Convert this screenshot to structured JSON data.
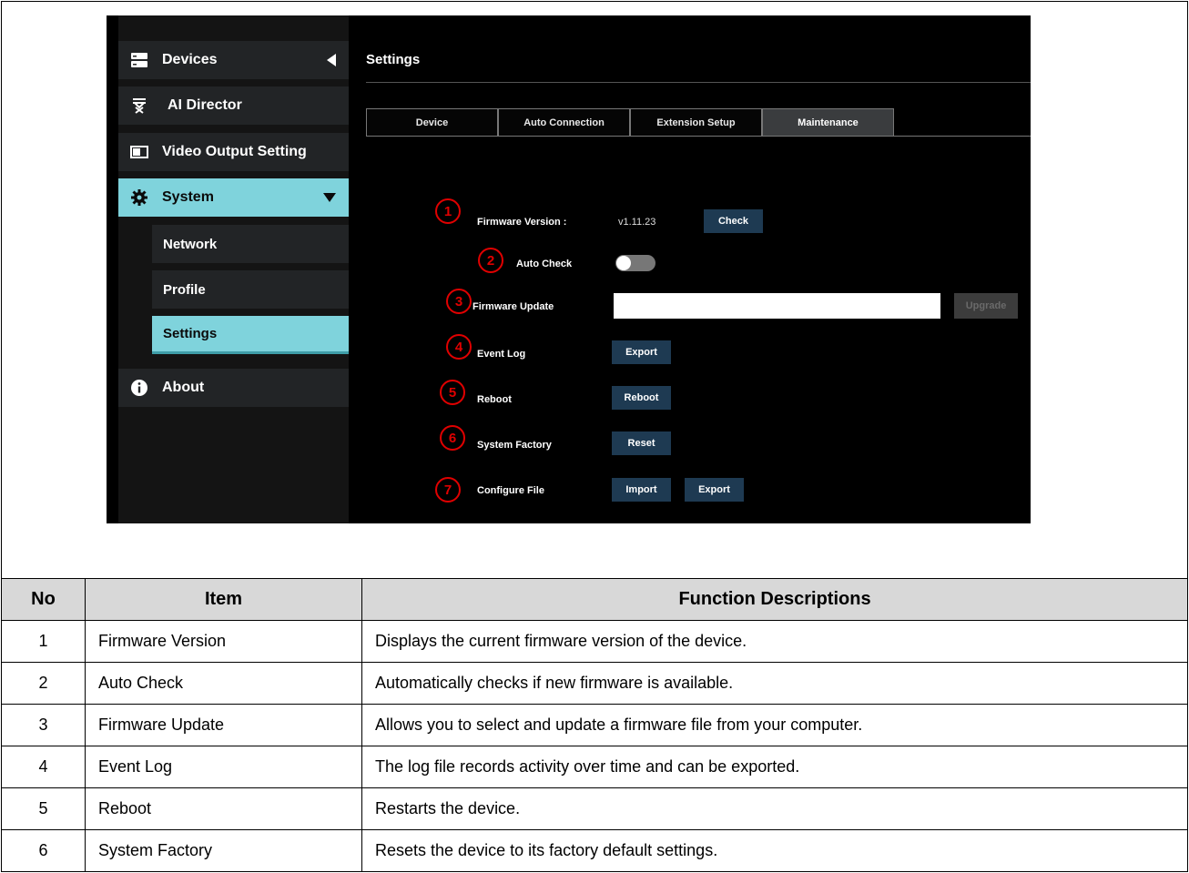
{
  "sidebar": {
    "items": [
      {
        "label": "Devices",
        "icon": "server-icon"
      },
      {
        "label": "AI Director",
        "icon": "director-chair-icon"
      },
      {
        "label": "Video Output Setting",
        "icon": "display-icon"
      },
      {
        "label": "System",
        "icon": "gear-icon"
      },
      {
        "label": "About",
        "icon": "info-icon"
      }
    ],
    "sub_items": [
      {
        "label": "Network"
      },
      {
        "label": "Profile"
      },
      {
        "label": "Settings"
      }
    ]
  },
  "main": {
    "title": "Settings",
    "tabs": [
      {
        "label": "Device"
      },
      {
        "label": "Auto Connection"
      },
      {
        "label": "Extension Setup"
      },
      {
        "label": "Maintenance"
      }
    ],
    "rows": [
      {
        "num": "1",
        "label": "Firmware Version :",
        "value": "v1.11.23",
        "button": "Check"
      },
      {
        "num": "2",
        "label": "Auto Check"
      },
      {
        "num": "3",
        "label": "Firmware Update",
        "button": "Upgrade"
      },
      {
        "num": "4",
        "label": "Event Log",
        "button": "Export"
      },
      {
        "num": "5",
        "label": "Reboot",
        "button": "Reboot"
      },
      {
        "num": "6",
        "label": "System Factory",
        "button": "Reset"
      },
      {
        "num": "7",
        "label": "Configure File",
        "button": "Import",
        "button2": "Export"
      }
    ]
  },
  "table": {
    "headers": [
      "No",
      "Item",
      "Function Descriptions"
    ],
    "rows": [
      [
        "1",
        "Firmware Version",
        "Displays the current firmware version of the device."
      ],
      [
        "2",
        "Auto Check",
        "Automatically checks if new firmware is available."
      ],
      [
        "3",
        "Firmware Update",
        "Allows you to select and update a firmware file from your computer."
      ],
      [
        "4",
        "Event Log",
        "The log file records activity over time and can be exported."
      ],
      [
        "5",
        "Reboot",
        "Restarts the device."
      ],
      [
        "6",
        "System Factory",
        "Resets the device to its factory default settings."
      ]
    ]
  },
  "colors": {
    "accent": "#7fd3dc",
    "marker": "#e00000",
    "button": "#1e3a52"
  }
}
